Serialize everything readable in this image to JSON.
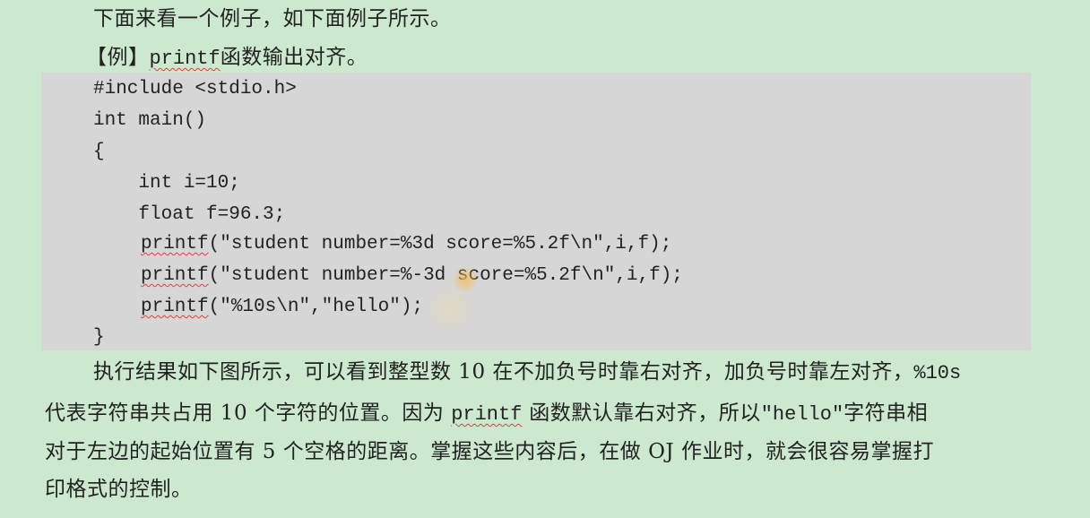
{
  "intro": "下面来看一个例子，如下面例子所示。",
  "example": {
    "tag": "【例】",
    "func": "printf",
    "title_rest": "函数输出对齐。"
  },
  "code_lines": [
    "#include <stdio.h>",
    "int main()",
    "{",
    "    int i=10;",
    "    float f=96.3;",
    "    printf(\"student number=%3d score=%5.2f\\n\",i,f);",
    "    printf(\"student number=%-3d score=%5.2f\\n\",i,f);",
    "    printf(\"%10s\\n\",\"hello\");",
    "}"
  ],
  "code_parts": {
    "printf": "printf",
    "p1_rest": "(\"student number=%3d score=%5.2f\\n\",i,f);",
    "p2_rest": "(\"student number=%-3d score=%5.2f\\n\",i,f);",
    "p3_rest": "(\"%10s\\n\",\"hello\");"
  },
  "explanation": {
    "l1a": "执行结果如下图所示，可以看到整型数 10 在不加负号时靠右对齐，加负号时靠左对齐，",
    "l1b": "%10s",
    "l2a": "代表字符串共占用 10 个字符的位置。因为 ",
    "l2b": "printf",
    "l2c": " 函数默认靠右对齐，所以",
    "l2d": "\"hello\"",
    "l2e": "字符串相",
    "l3": "对于左边的起始位置有 5 个空格的距离。掌握这些内容后，在做 OJ 作业时，就会很容易掌握打",
    "l4": "印格式的控制。"
  }
}
